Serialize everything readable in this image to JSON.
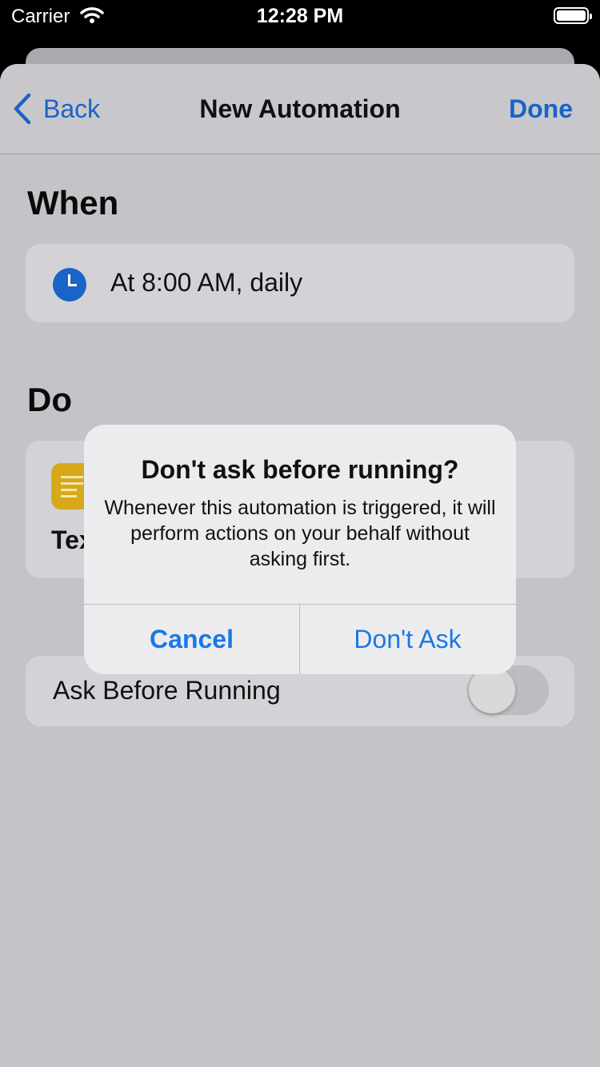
{
  "status_bar": {
    "carrier": "Carrier",
    "time": "12:28 PM"
  },
  "navbar": {
    "back_label": "Back",
    "title": "New Automation",
    "done_label": "Done"
  },
  "when": {
    "heading": "When",
    "trigger": "At 8:00 AM, daily"
  },
  "do": {
    "heading": "Do",
    "action_label_visible": "Tex"
  },
  "ask_before_running": {
    "label": "Ask Before Running",
    "enabled": false
  },
  "alert": {
    "title": "Don't ask before running?",
    "message": "Whenever this automation is triggered, it will perform actions on your behalf without asking first.",
    "cancel_label": "Cancel",
    "confirm_label": "Don't Ask"
  },
  "colors": {
    "accent": "#1a63c8",
    "alert_button": "#1a78e6",
    "action_icon": "#d7a91a"
  }
}
